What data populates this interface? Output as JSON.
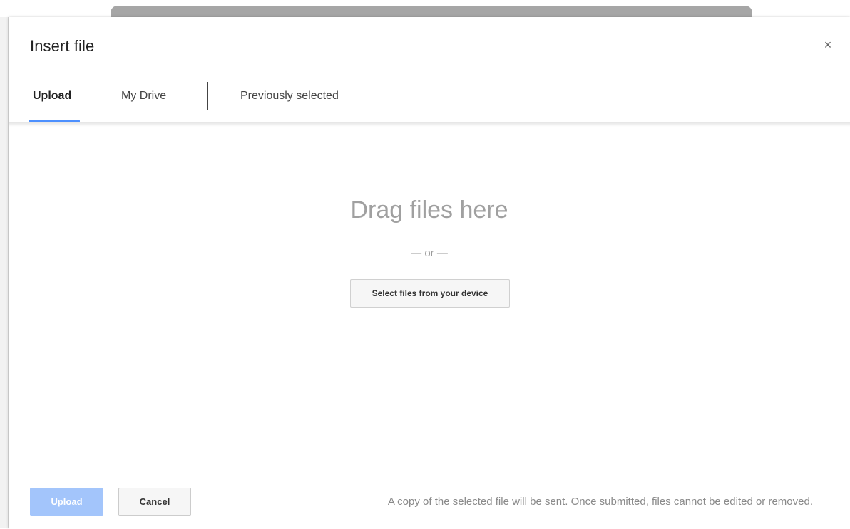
{
  "dialog": {
    "title": "Insert file",
    "close_glyph": "×"
  },
  "tabs": [
    {
      "label": "Upload",
      "active": true
    },
    {
      "label": "My Drive",
      "active": false
    },
    {
      "label": "Previously selected",
      "active": false
    }
  ],
  "dropzone": {
    "heading": "Drag files here",
    "separator": "— or —",
    "select_button_label": "Select files from your device"
  },
  "footer": {
    "upload_label": "Upload",
    "cancel_label": "Cancel",
    "note": "A copy of the selected file will be sent. Once submitted, files cannot be edited or removed."
  },
  "colors": {
    "accent": "#4d90fe",
    "upload_disabled_bg": "#a3c5fb",
    "muted_text": "#a0a0a0"
  },
  "icons": {
    "close": "close-icon"
  }
}
